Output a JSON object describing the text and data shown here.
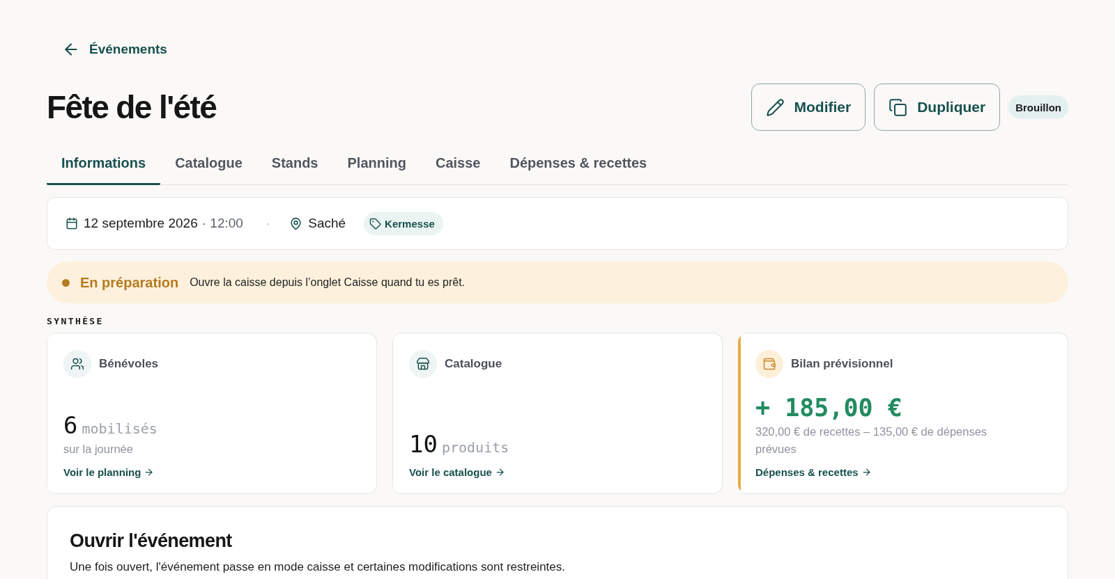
{
  "back_link": {
    "label": "Événements"
  },
  "title": "Fête de l'été",
  "actions": [
    {
      "kind": "edit",
      "label": "Modifier"
    },
    {
      "kind": "duplicate",
      "label": "Dupliquer"
    }
  ],
  "status_badge": "Brouillon",
  "tabs": [
    {
      "label": "Informations",
      "selected": true
    },
    {
      "label": "Catalogue",
      "selected": false
    },
    {
      "label": "Stands",
      "selected": false
    },
    {
      "label": "Planning",
      "selected": false
    },
    {
      "label": "Caisse",
      "selected": false
    },
    {
      "label": "Dépenses & recettes",
      "selected": false
    }
  ],
  "details": {
    "date": "12 septembre 2026",
    "time": "· 12:00",
    "separator": "·",
    "location": "Saché",
    "tag": "Kermesse"
  },
  "banner": {
    "status": "En préparation",
    "message": "Ouvre la caisse depuis l’onglet Caisse quand tu es prêt."
  },
  "section_label": "SYNTHÈSE",
  "cards": [
    {
      "kind": "volunteers",
      "title": "Bénévoles",
      "value": "6",
      "unit": "mobilisés",
      "note": "sur la journée",
      "link": "Voir le planning",
      "highlighted": false
    },
    {
      "kind": "catalogue",
      "title": "Catalogue",
      "value": "10",
      "unit": "produits",
      "link": "Voir le catalogue",
      "highlighted": false
    },
    {
      "kind": "balance",
      "title": "Bilan prévisionnel",
      "value": "+ 185,00 €",
      "note": "320,00 € de recettes – 135,00 € de dépenses prévues",
      "link": "Dépenses & recettes",
      "highlighted": true
    }
  ],
  "open_section": {
    "title": "Ouvrir l'événement",
    "description": "Une fois ouvert, l'événement passe en mode caisse et certaines modifications sont restreintes."
  }
}
